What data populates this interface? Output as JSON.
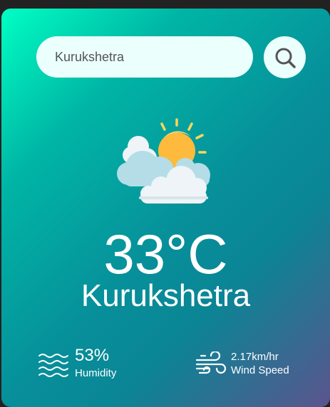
{
  "search": {
    "value": "Kurukshetra",
    "button_icon": "search-icon"
  },
  "weather": {
    "icon": "partly-cloudy-icon",
    "temperature": "33°C",
    "city": "Kurukshetra"
  },
  "details": {
    "humidity": {
      "icon": "humidity-waves-icon",
      "value": "53%",
      "label": "Humidity"
    },
    "wind": {
      "icon": "wind-icon",
      "value": "2.17km/hr",
      "label": "Wind Speed"
    }
  },
  "colors": {
    "card_gradient_start": "#00ffc3",
    "card_gradient_mid": "#078f9a",
    "card_gradient_end": "#5b548d",
    "search_background": "#ebfffc",
    "text": "#ffffff"
  }
}
